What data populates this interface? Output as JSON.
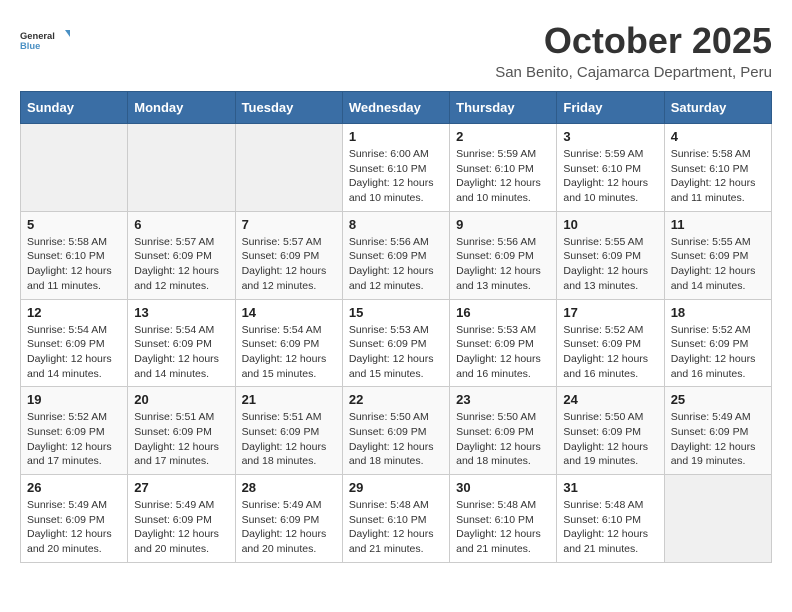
{
  "header": {
    "logo_general": "General",
    "logo_blue": "Blue",
    "title": "October 2025",
    "subtitle": "San Benito, Cajamarca Department, Peru"
  },
  "weekdays": [
    "Sunday",
    "Monday",
    "Tuesday",
    "Wednesday",
    "Thursday",
    "Friday",
    "Saturday"
  ],
  "weeks": [
    [
      {
        "day": "",
        "info": ""
      },
      {
        "day": "",
        "info": ""
      },
      {
        "day": "",
        "info": ""
      },
      {
        "day": "1",
        "info": "Sunrise: 6:00 AM\nSunset: 6:10 PM\nDaylight: 12 hours\nand 10 minutes."
      },
      {
        "day": "2",
        "info": "Sunrise: 5:59 AM\nSunset: 6:10 PM\nDaylight: 12 hours\nand 10 minutes."
      },
      {
        "day": "3",
        "info": "Sunrise: 5:59 AM\nSunset: 6:10 PM\nDaylight: 12 hours\nand 10 minutes."
      },
      {
        "day": "4",
        "info": "Sunrise: 5:58 AM\nSunset: 6:10 PM\nDaylight: 12 hours\nand 11 minutes."
      }
    ],
    [
      {
        "day": "5",
        "info": "Sunrise: 5:58 AM\nSunset: 6:10 PM\nDaylight: 12 hours\nand 11 minutes."
      },
      {
        "day": "6",
        "info": "Sunrise: 5:57 AM\nSunset: 6:09 PM\nDaylight: 12 hours\nand 12 minutes."
      },
      {
        "day": "7",
        "info": "Sunrise: 5:57 AM\nSunset: 6:09 PM\nDaylight: 12 hours\nand 12 minutes."
      },
      {
        "day": "8",
        "info": "Sunrise: 5:56 AM\nSunset: 6:09 PM\nDaylight: 12 hours\nand 12 minutes."
      },
      {
        "day": "9",
        "info": "Sunrise: 5:56 AM\nSunset: 6:09 PM\nDaylight: 12 hours\nand 13 minutes."
      },
      {
        "day": "10",
        "info": "Sunrise: 5:55 AM\nSunset: 6:09 PM\nDaylight: 12 hours\nand 13 minutes."
      },
      {
        "day": "11",
        "info": "Sunrise: 5:55 AM\nSunset: 6:09 PM\nDaylight: 12 hours\nand 14 minutes."
      }
    ],
    [
      {
        "day": "12",
        "info": "Sunrise: 5:54 AM\nSunset: 6:09 PM\nDaylight: 12 hours\nand 14 minutes."
      },
      {
        "day": "13",
        "info": "Sunrise: 5:54 AM\nSunset: 6:09 PM\nDaylight: 12 hours\nand 14 minutes."
      },
      {
        "day": "14",
        "info": "Sunrise: 5:54 AM\nSunset: 6:09 PM\nDaylight: 12 hours\nand 15 minutes."
      },
      {
        "day": "15",
        "info": "Sunrise: 5:53 AM\nSunset: 6:09 PM\nDaylight: 12 hours\nand 15 minutes."
      },
      {
        "day": "16",
        "info": "Sunrise: 5:53 AM\nSunset: 6:09 PM\nDaylight: 12 hours\nand 16 minutes."
      },
      {
        "day": "17",
        "info": "Sunrise: 5:52 AM\nSunset: 6:09 PM\nDaylight: 12 hours\nand 16 minutes."
      },
      {
        "day": "18",
        "info": "Sunrise: 5:52 AM\nSunset: 6:09 PM\nDaylight: 12 hours\nand 16 minutes."
      }
    ],
    [
      {
        "day": "19",
        "info": "Sunrise: 5:52 AM\nSunset: 6:09 PM\nDaylight: 12 hours\nand 17 minutes."
      },
      {
        "day": "20",
        "info": "Sunrise: 5:51 AM\nSunset: 6:09 PM\nDaylight: 12 hours\nand 17 minutes."
      },
      {
        "day": "21",
        "info": "Sunrise: 5:51 AM\nSunset: 6:09 PM\nDaylight: 12 hours\nand 18 minutes."
      },
      {
        "day": "22",
        "info": "Sunrise: 5:50 AM\nSunset: 6:09 PM\nDaylight: 12 hours\nand 18 minutes."
      },
      {
        "day": "23",
        "info": "Sunrise: 5:50 AM\nSunset: 6:09 PM\nDaylight: 12 hours\nand 18 minutes."
      },
      {
        "day": "24",
        "info": "Sunrise: 5:50 AM\nSunset: 6:09 PM\nDaylight: 12 hours\nand 19 minutes."
      },
      {
        "day": "25",
        "info": "Sunrise: 5:49 AM\nSunset: 6:09 PM\nDaylight: 12 hours\nand 19 minutes."
      }
    ],
    [
      {
        "day": "26",
        "info": "Sunrise: 5:49 AM\nSunset: 6:09 PM\nDaylight: 12 hours\nand 20 minutes."
      },
      {
        "day": "27",
        "info": "Sunrise: 5:49 AM\nSunset: 6:09 PM\nDaylight: 12 hours\nand 20 minutes."
      },
      {
        "day": "28",
        "info": "Sunrise: 5:49 AM\nSunset: 6:09 PM\nDaylight: 12 hours\nand 20 minutes."
      },
      {
        "day": "29",
        "info": "Sunrise: 5:48 AM\nSunset: 6:10 PM\nDaylight: 12 hours\nand 21 minutes."
      },
      {
        "day": "30",
        "info": "Sunrise: 5:48 AM\nSunset: 6:10 PM\nDaylight: 12 hours\nand 21 minutes."
      },
      {
        "day": "31",
        "info": "Sunrise: 5:48 AM\nSunset: 6:10 PM\nDaylight: 12 hours\nand 21 minutes."
      },
      {
        "day": "",
        "info": ""
      }
    ]
  ]
}
